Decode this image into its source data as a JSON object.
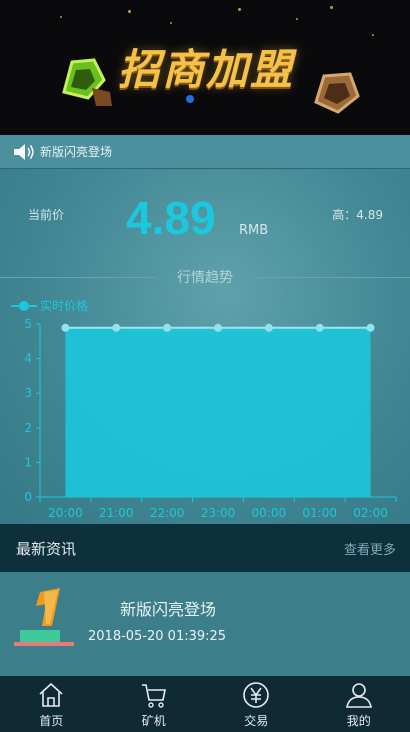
{
  "banner": {
    "title": "招商加盟"
  },
  "notice": {
    "text": "新版闪亮登场"
  },
  "price": {
    "current_label": "当前价",
    "value": "4.89",
    "unit": "RMB",
    "high_label": "高：4.89"
  },
  "trend_title": "行情趋势",
  "chart_data": {
    "type": "area",
    "series": [
      {
        "name": "实时价格",
        "values": [
          4.89,
          4.89,
          4.89,
          4.89,
          4.89,
          4.89,
          4.89
        ]
      }
    ],
    "categories": [
      "20:00",
      "21:00",
      "22:00",
      "23:00",
      "00:00",
      "01:00",
      "02:00"
    ],
    "yticks": [
      "0",
      "1",
      "2",
      "3",
      "4",
      "5"
    ],
    "ylim": [
      0,
      5
    ],
    "legend": "top-left",
    "color": "#1bc8dc"
  },
  "news": {
    "header": "最新资讯",
    "more": "查看更多",
    "items": [
      {
        "title": "新版闪亮登场",
        "date": "2018-05-20 01:39:25"
      }
    ]
  },
  "tabs": [
    {
      "label": "首页",
      "icon": "home-icon"
    },
    {
      "label": "矿机",
      "icon": "cart-icon"
    },
    {
      "label": "交易",
      "icon": "yen-icon"
    },
    {
      "label": "我的",
      "icon": "user-icon"
    }
  ]
}
